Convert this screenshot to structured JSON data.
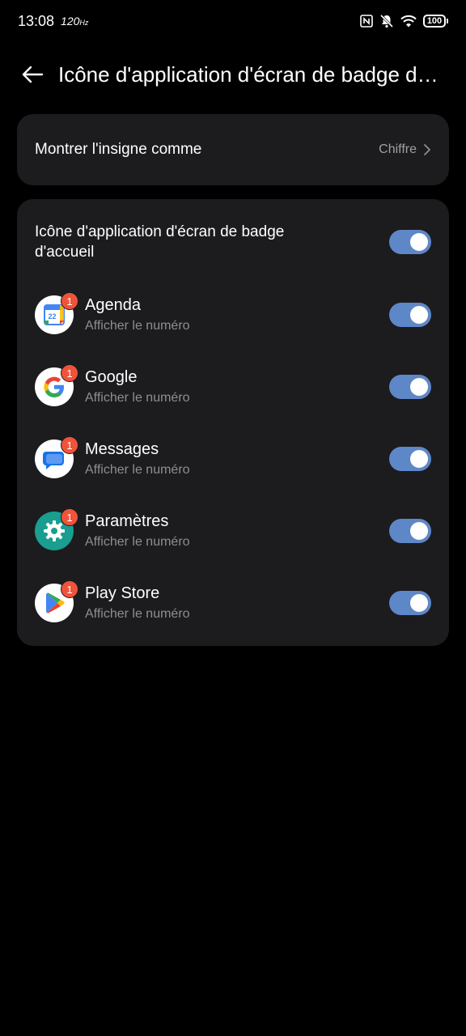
{
  "status_bar": {
    "time": "13:08",
    "refresh_rate": "120",
    "battery": "100",
    "icons": [
      "nfc-icon",
      "mute-bell-icon",
      "wifi-icon",
      "battery-icon"
    ]
  },
  "header": {
    "title": "Icône d'application d'écran de badge d'accueil"
  },
  "badge_setting": {
    "label": "Montrer l'insigne comme",
    "value": "Chiffre"
  },
  "master": {
    "label": "Icône d'application d'écran de badge d'accueil",
    "enabled": true
  },
  "apps": [
    {
      "name": "Agenda",
      "subtitle": "Afficher le numéro",
      "badge": "1",
      "icon": "calendar-icon",
      "enabled": true,
      "calendar_day": "22"
    },
    {
      "name": "Google",
      "subtitle": "Afficher le numéro",
      "badge": "1",
      "icon": "google-icon",
      "enabled": true
    },
    {
      "name": "Messages",
      "subtitle": "Afficher le numéro",
      "badge": "1",
      "icon": "messages-icon",
      "enabled": true
    },
    {
      "name": "Paramètres",
      "subtitle": "Afficher le numéro",
      "badge": "1",
      "icon": "settings-gear-icon",
      "enabled": true
    },
    {
      "name": "Play Store",
      "subtitle": "Afficher le numéro",
      "badge": "1",
      "icon": "play-store-icon",
      "enabled": true
    }
  ],
  "colors": {
    "background": "#000000",
    "card": "#1c1c1e",
    "toggle_on": "#5e87c7",
    "badge": "#f0533a",
    "secondary_text": "#8e8e93"
  }
}
